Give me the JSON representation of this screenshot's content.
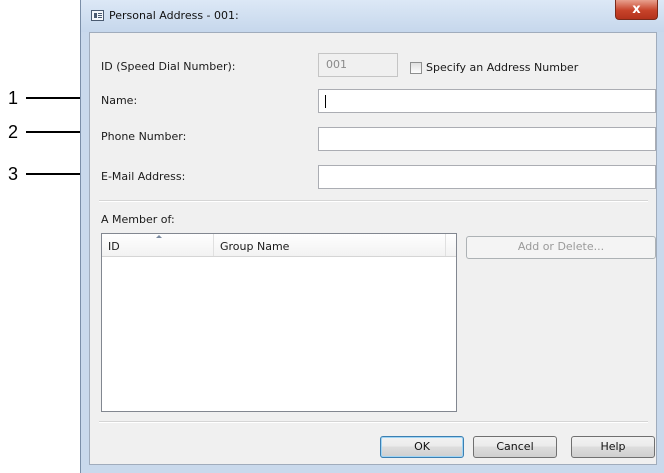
{
  "callouts": [
    "1",
    "2",
    "3"
  ],
  "window": {
    "title": "Personal Address - 001:",
    "close_symbol": "x",
    "icon": "address-card-icon"
  },
  "form": {
    "id_label": "ID (Speed Dial Number):",
    "id_value": "001",
    "specify_label": "Specify an Address Number",
    "specify_checked": false,
    "name_label": "Name:",
    "name_value": "",
    "phone_label": "Phone Number:",
    "phone_value": "",
    "email_label": "E-Mail Address:",
    "email_value": ""
  },
  "member": {
    "label": "A Member of:",
    "columns": [
      "ID",
      "Group Name"
    ],
    "rows": [],
    "add_delete_label": "Add or Delete..."
  },
  "buttons": {
    "ok": "OK",
    "cancel": "Cancel",
    "help": "Help"
  }
}
